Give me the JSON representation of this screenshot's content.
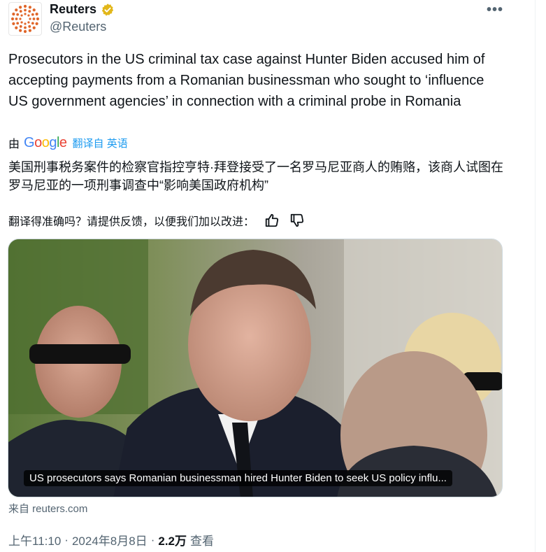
{
  "author": {
    "display_name": "Reuters",
    "handle": "@Reuters",
    "logo_icon": "reuters-logo-icon",
    "verified_color": "#e2b719"
  },
  "more_label": "•••",
  "tweet": {
    "text": "Prosecutors in the US criminal tax case against Hunter Biden accused him of accepting payments from a Romanian businessman who sought to ‘influence US government agencies’ in connection with a criminal probe in Romania"
  },
  "translation": {
    "prefix": "由",
    "provider": "Google",
    "link": "翻译自 英语",
    "text": "美国刑事税务案件的检察官指控亨特·拜登接受了一名罗马尼亚商人的贿赂，该商人试图在罗马尼亚的一项刑事调查中“影响美国政府机构”",
    "feedback_prompt": "翻译得准确吗？请提供反馈，以便我们加以改进："
  },
  "media": {
    "caption": "US prosecutors says Romanian businessman hired Hunter Biden to seek US policy influ..."
  },
  "source": "来自 reuters.com",
  "meta": {
    "time": "上午11:10",
    "date": "2024年8月8日",
    "views": "2.2万",
    "views_label": "查看"
  },
  "colors": {
    "link": "#1d9bf0",
    "secondary_text": "#536471",
    "reuters_orange": "#e0662a"
  }
}
